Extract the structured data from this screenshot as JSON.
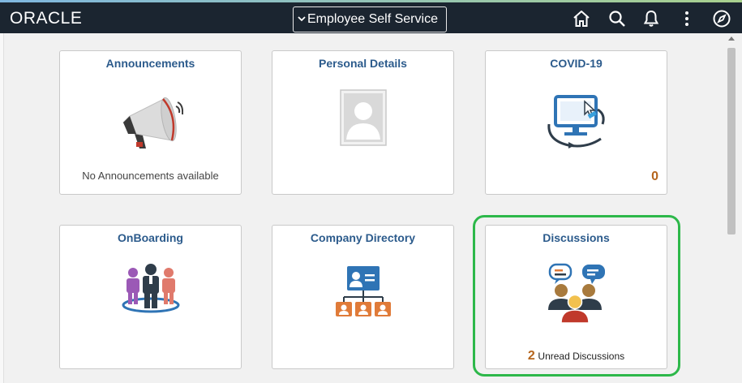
{
  "header": {
    "brand": "ORACLE",
    "page_title": "Employee Self Service",
    "icons": [
      "home-icon",
      "search-icon",
      "bell-icon",
      "more-options-icon",
      "navigator-compass-icon"
    ]
  },
  "tiles": [
    {
      "title": "Announcements",
      "footer": "No Announcements available",
      "icon": "megaphone-icon"
    },
    {
      "title": "Personal Details",
      "icon": "person-photo-icon"
    },
    {
      "title": "COVID-19",
      "count": "0",
      "icon": "monitor-click-icon"
    },
    {
      "title": "OnBoarding",
      "icon": "people-group-icon"
    },
    {
      "title": "Company Directory",
      "icon": "org-chart-icon"
    },
    {
      "title": "Discussions",
      "count": "2",
      "count_label": "Unread Discussions",
      "icon": "discussion-people-icon"
    }
  ],
  "colors": {
    "header_bg": "#1b2530",
    "tile_title": "#2c5b8c",
    "count": "#b5651d",
    "highlight": "#2db84a"
  }
}
